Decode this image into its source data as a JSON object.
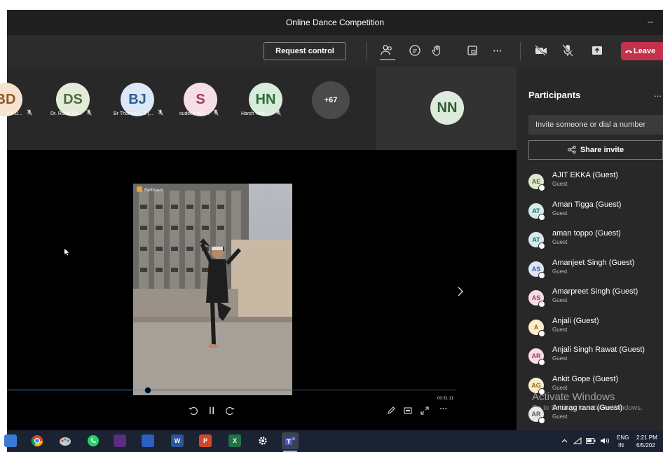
{
  "window": {
    "title": "Online Dance Competition",
    "minimize_glyph": "–"
  },
  "toolbar": {
    "request_control": "Request control",
    "more": "···",
    "leave": "Leave",
    "icons": [
      "people-icon",
      "chat-icon",
      "raise-hand-icon",
      "rooms-icon",
      "more-icon",
      "camera-off-icon",
      "mic-off-icon",
      "share-tray-icon",
      "phone-icon"
    ]
  },
  "avatars": [
    {
      "initials": "BD",
      "name": "KA D...",
      "bg": "#f6e2cf",
      "fg": "#8a5a2b"
    },
    {
      "initials": "DS",
      "name": "Dr. Ruchi Sa...",
      "bg": "#e3ecd9",
      "fg": "#4f6b3c"
    },
    {
      "initials": "BJ",
      "name": "Br Thomas C J (...",
      "bg": "#dce8f5",
      "fg": "#2d5f94"
    },
    {
      "initials": "S",
      "name": "sudeep (Gu...",
      "bg": "#f7dde6",
      "fg": "#a13a5e"
    },
    {
      "initials": "HN",
      "name": "Harsh Negi ...",
      "bg": "#d7ecd9",
      "fg": "#2f6b3b"
    },
    {
      "initials": "+67",
      "name": "",
      "bg": "#4a4a4a",
      "fg": "#ffffff"
    }
  ],
  "featured": {
    "initials": "NN"
  },
  "video": {
    "time": "00:31:11",
    "overlay_text": "Partnave",
    "progress": 0.31
  },
  "panel": {
    "title": "Participants",
    "more": "...",
    "invite_placeholder": "Invite someone or dial a number",
    "share_invite": "Share invite",
    "participants": [
      {
        "initials": "AE",
        "name": "AJIT EKKA (Guest)",
        "role": "Guest",
        "bg": "#dfe8cf",
        "fg": "#4f6b3c"
      },
      {
        "initials": "AT",
        "name": "Aman Tigga (Guest)",
        "role": "Guest",
        "bg": "#d4ece9",
        "fg": "#246a63"
      },
      {
        "initials": "AT",
        "name": "aman toppo (Guest)",
        "role": "Guest",
        "bg": "#d4ece9",
        "fg": "#246a63"
      },
      {
        "initials": "AS",
        "name": "Amanjeet Singh (Guest)",
        "role": "Guest",
        "bg": "#dce4f5",
        "fg": "#3c5a9a"
      },
      {
        "initials": "AS",
        "name": "Amarpreet Singh (Guest)",
        "role": "Guest",
        "bg": "#f7dde6",
        "fg": "#a13a5e"
      },
      {
        "initials": "A",
        "name": "Anjali (Guest)",
        "role": "Guest",
        "bg": "#fbeccb",
        "fg": "#8a6a1a"
      },
      {
        "initials": "AR",
        "name": "Anjali Singh Rawat (Guest)",
        "role": "Guest",
        "bg": "#f7dde6",
        "fg": "#a13a5e"
      },
      {
        "initials": "AG",
        "name": "Ankit Gope (Guest)",
        "role": "Guest",
        "bg": "#fbeccb",
        "fg": "#8a6a1a"
      },
      {
        "initials": "AR",
        "name": "Anurag rana (Guest)",
        "role": "Guest",
        "bg": "#e6e6e6",
        "fg": "#555555"
      }
    ]
  },
  "watermark": {
    "title": "Activate Windows",
    "subtitle": "Go to Settings to activate Windows."
  },
  "taskbar": {
    "tray_lang": "ENG",
    "tray_region": "IN",
    "time": "2:21 PM",
    "date": "6/5/202",
    "apps": [
      "W",
      "P",
      "X"
    ]
  }
}
